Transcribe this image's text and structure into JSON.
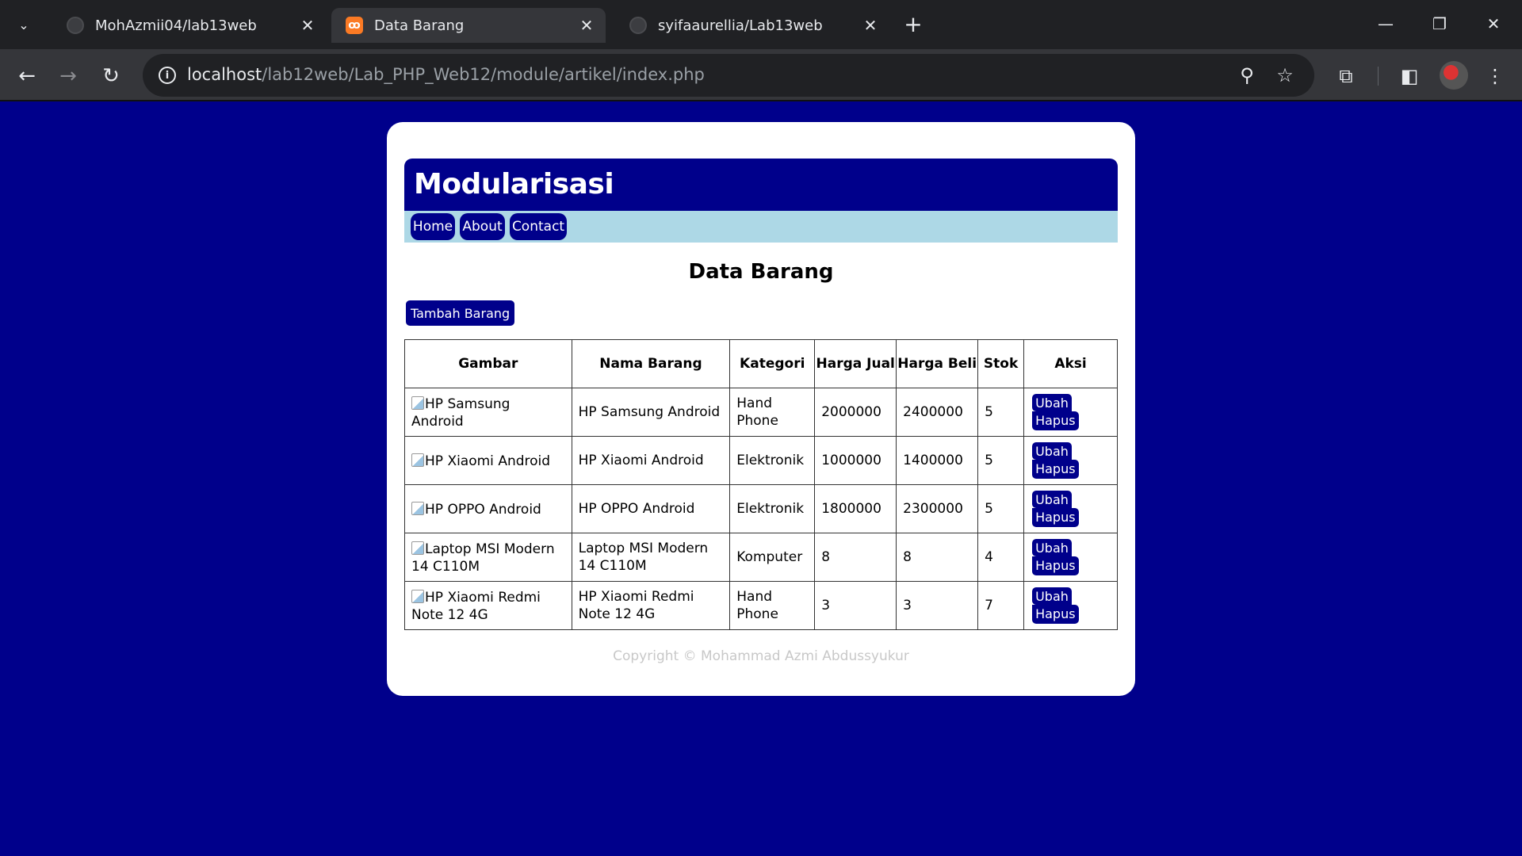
{
  "browser": {
    "tabs": [
      {
        "title": "MohAzmii04/lab13web",
        "active": false,
        "icon": "github-icon"
      },
      {
        "title": "Data Barang",
        "active": true,
        "icon": "xampp-icon"
      },
      {
        "title": "syifaaurellia/Lab13web",
        "active": false,
        "icon": "github-icon"
      }
    ],
    "url_host": "localhost",
    "url_path": "/lab12web/Lab_PHP_Web12/module/artikel/index.php"
  },
  "colors": {
    "background": "#00008b",
    "nav_bar": "#add8e6",
    "button": "#00008b"
  },
  "header": {
    "title": "Modularisasi"
  },
  "nav": {
    "home": "Home",
    "about": "About",
    "contact": "Contact"
  },
  "page": {
    "title": "Data Barang",
    "add_button": "Tambah Barang"
  },
  "table": {
    "columns": {
      "gambar": "Gambar",
      "nama": "Nama Barang",
      "kategori": "Kategori",
      "harga_jual": "Harga Jual",
      "harga_beli": "Harga Beli",
      "stok": "Stok",
      "aksi": "Aksi"
    },
    "rows": [
      {
        "gambar_alt": "HP Samsung Android",
        "nama": "HP Samsung Android",
        "kategori": "Hand Phone",
        "harga_jual": "2000000",
        "harga_beli": "2400000",
        "stok": "5",
        "ubah": "Ubah",
        "hapus": "Hapus"
      },
      {
        "gambar_alt": "HP Xiaomi Android",
        "nama": "HP Xiaomi Android",
        "kategori": "Elektronik",
        "harga_jual": "1000000",
        "harga_beli": "1400000",
        "stok": "5",
        "ubah": "Ubah",
        "hapus": "Hapus"
      },
      {
        "gambar_alt": "HP OPPO Android",
        "nama": "HP OPPO Android",
        "kategori": "Elektronik",
        "harga_jual": "1800000",
        "harga_beli": "2300000",
        "stok": "5",
        "ubah": "Ubah",
        "hapus": "Hapus"
      },
      {
        "gambar_alt": "Laptop MSI Modern 14 C110M",
        "nama": "Laptop MSI Modern 14 C110M",
        "kategori": "Komputer",
        "harga_jual": "8",
        "harga_beli": "8",
        "stok": "4",
        "ubah": "Ubah",
        "hapus": "Hapus"
      },
      {
        "gambar_alt": "HP Xiaomi Redmi Note 12 4G",
        "nama": "HP Xiaomi Redmi Note 12 4G",
        "kategori": "Hand Phone",
        "harga_jual": "3",
        "harga_beli": "3",
        "stok": "7",
        "ubah": "Ubah",
        "hapus": "Hapus"
      }
    ]
  },
  "footer": {
    "text": "Copyright © Mohammad Azmi Abdussyukur"
  }
}
